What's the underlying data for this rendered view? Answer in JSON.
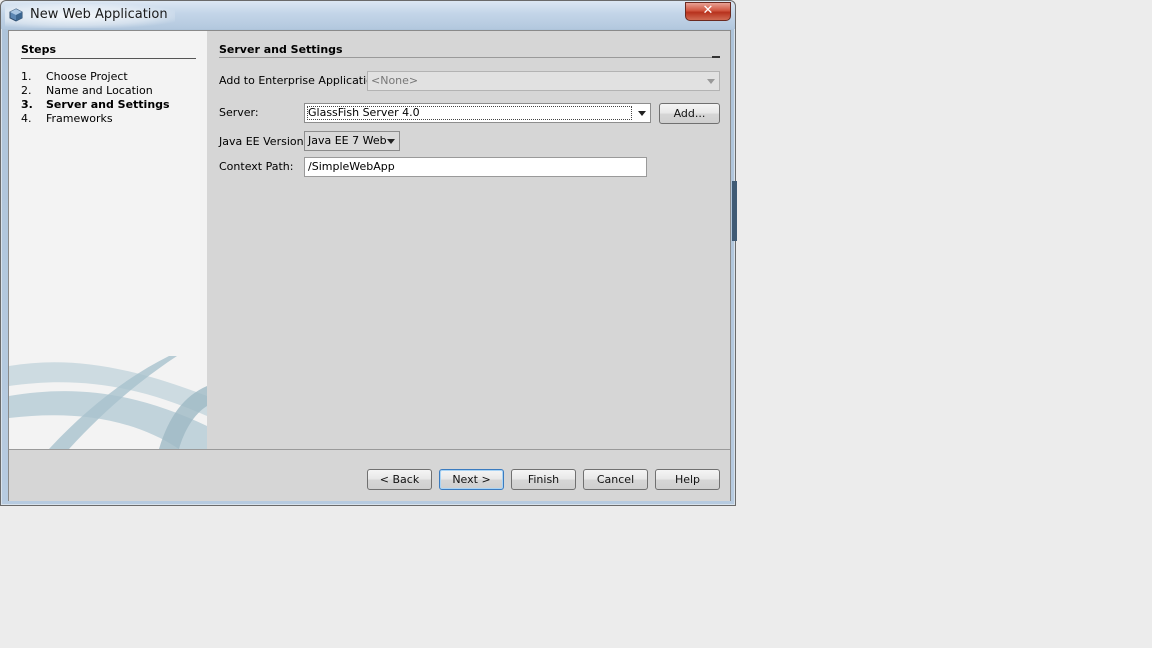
{
  "window": {
    "title": "New Web Application",
    "close_glyph": "✕",
    "icon": "app-cube-icon"
  },
  "steps": {
    "title": "Steps",
    "items": [
      {
        "num": "1.",
        "label": "Choose Project"
      },
      {
        "num": "2.",
        "label": "Name and Location"
      },
      {
        "num": "3.",
        "label": "Server and Settings"
      },
      {
        "num": "4.",
        "label": "Frameworks"
      }
    ],
    "current_index": 2
  },
  "content": {
    "title": "Server and Settings",
    "enterprise_label": "Add to Enterprise Application:",
    "enterprise_value": "<None>",
    "server_label": "Server:",
    "server_value": "GlassFish Server 4.0",
    "add_label": "Add...",
    "javaee_label": "Java EE Version:",
    "javaee_value": "Java EE 7 Web",
    "context_label": "Context Path:",
    "context_value": "/SimpleWebApp"
  },
  "footer": {
    "back": "< Back",
    "next": "Next >",
    "finish": "Finish",
    "cancel": "Cancel",
    "help": "Help"
  },
  "colors": {
    "close_red": "#c9432c",
    "default_button_border": "#3b7bbf",
    "panel_gray": "#d6d6d6"
  }
}
